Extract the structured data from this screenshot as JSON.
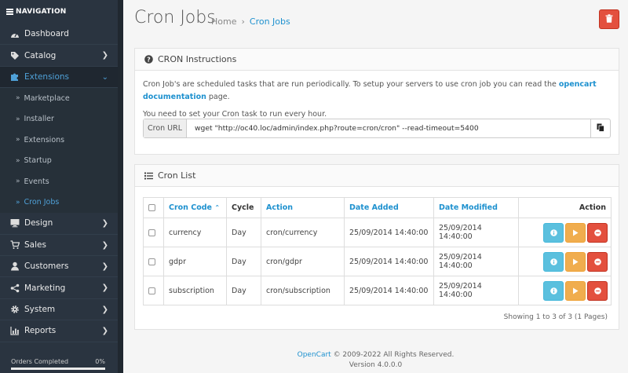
{
  "sidebar": {
    "header": "NAVIGATION",
    "items": [
      {
        "label": "Dashboard",
        "icon": "dashboard-icon"
      },
      {
        "label": "Catalog",
        "icon": "tag-icon"
      },
      {
        "label": "Extensions",
        "icon": "puzzle-icon"
      },
      {
        "label": "Design",
        "icon": "monitor-icon"
      },
      {
        "label": "Sales",
        "icon": "cart-icon"
      },
      {
        "label": "Customers",
        "icon": "user-icon"
      },
      {
        "label": "Marketing",
        "icon": "share-icon"
      },
      {
        "label": "System",
        "icon": "gear-icon"
      },
      {
        "label": "Reports",
        "icon": "bar-chart-icon"
      }
    ],
    "submenu": [
      "Marketplace",
      "Installer",
      "Extensions",
      "Startup",
      "Events",
      "Cron Jobs"
    ],
    "progress": {
      "label": "Orders Completed",
      "value": "0%"
    }
  },
  "header": {
    "title": "Cron Jobs",
    "breadcrumb": [
      "Home",
      "Cron Jobs"
    ]
  },
  "instructions": {
    "title": "CRON Instructions",
    "text1_before": "Cron Job's are scheduled tasks that are run periodically. To setup your servers to use cron job you can read the ",
    "text1_link": "opencart documentation",
    "text1_after": " page.",
    "text2": "You need to set your Cron task to run every hour.",
    "url_label": "Cron URL",
    "url_value": "wget \"http://oc40.loc/admin/index.php?route=cron/cron\" --read-timeout=5400"
  },
  "cron_list": {
    "title": "Cron List",
    "columns": {
      "code": "Cron Code",
      "cycle": "Cycle",
      "action": "Action",
      "date_added": "Date Added",
      "date_modified": "Date Modified",
      "actions": "Action"
    },
    "rows": [
      {
        "code": "currency",
        "cycle": "Day",
        "action": "cron/currency",
        "date_added": "25/09/2014 14:40:00",
        "date_modified": "25/09/2014 14:40:00"
      },
      {
        "code": "gdpr",
        "cycle": "Day",
        "action": "cron/gdpr",
        "date_added": "25/09/2014 14:40:00",
        "date_modified": "25/09/2014 14:40:00"
      },
      {
        "code": "subscription",
        "cycle": "Day",
        "action": "cron/subscription",
        "date_added": "25/09/2014 14:40:00",
        "date_modified": "25/09/2014 14:40:00"
      }
    ],
    "showing": "Showing 1 to 3 of 3 (1 Pages)"
  },
  "footer": {
    "brand": "OpenCart",
    "copyright": " © 2009-2022 All Rights Reserved.",
    "version": "Version 4.0.0.0"
  }
}
